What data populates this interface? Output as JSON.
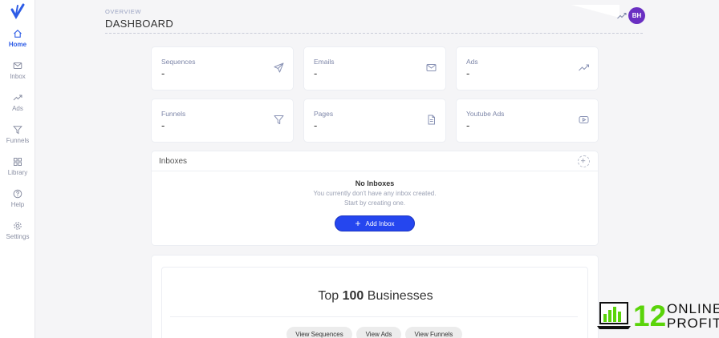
{
  "sidebar": {
    "items": [
      {
        "label": "Home",
        "icon": "home-icon",
        "active": true
      },
      {
        "label": "Inbox",
        "icon": "mail-icon"
      },
      {
        "label": "Ads",
        "icon": "trend-icon"
      },
      {
        "label": "Funnels",
        "icon": "funnel-icon"
      },
      {
        "label": "Library",
        "icon": "grid-icon"
      },
      {
        "label": "Help",
        "icon": "help-icon"
      },
      {
        "label": "Settings",
        "icon": "gear-icon"
      }
    ]
  },
  "header": {
    "overline": "OVERVIEW",
    "title": "DASHBOARD",
    "avatar_initials": "BH"
  },
  "stats": [
    {
      "label": "Sequences",
      "value": "-",
      "icon": "send-icon"
    },
    {
      "label": "Emails",
      "value": "-",
      "icon": "mail-icon"
    },
    {
      "label": "Ads",
      "value": "-",
      "icon": "trend-icon"
    },
    {
      "label": "Funnels",
      "value": "-",
      "icon": "funnel-icon"
    },
    {
      "label": "Pages",
      "value": "-",
      "icon": "document-icon"
    },
    {
      "label": "Youtube Ads",
      "value": "-",
      "icon": "play-icon"
    }
  ],
  "inboxes": {
    "title": "Inboxes",
    "empty_title": "No Inboxes",
    "empty_line1": "You currently don't have any inbox created.",
    "empty_line2": "Start by creating one.",
    "add_button": "Add Inbox",
    "add_button_icon": "+"
  },
  "top_businesses": {
    "title_prefix": "Top",
    "title_number": "100",
    "title_suffix": "Businesses",
    "buttons": [
      "View Sequences",
      "View Ads",
      "View Funnels"
    ]
  },
  "watermark": {
    "number": "12",
    "line1": "ONLINE",
    "line2": "PROFIT$"
  },
  "colors": {
    "accent": "#2546ef",
    "avatar": "#6a2fc2",
    "watermark_green": "#5ad40a"
  }
}
